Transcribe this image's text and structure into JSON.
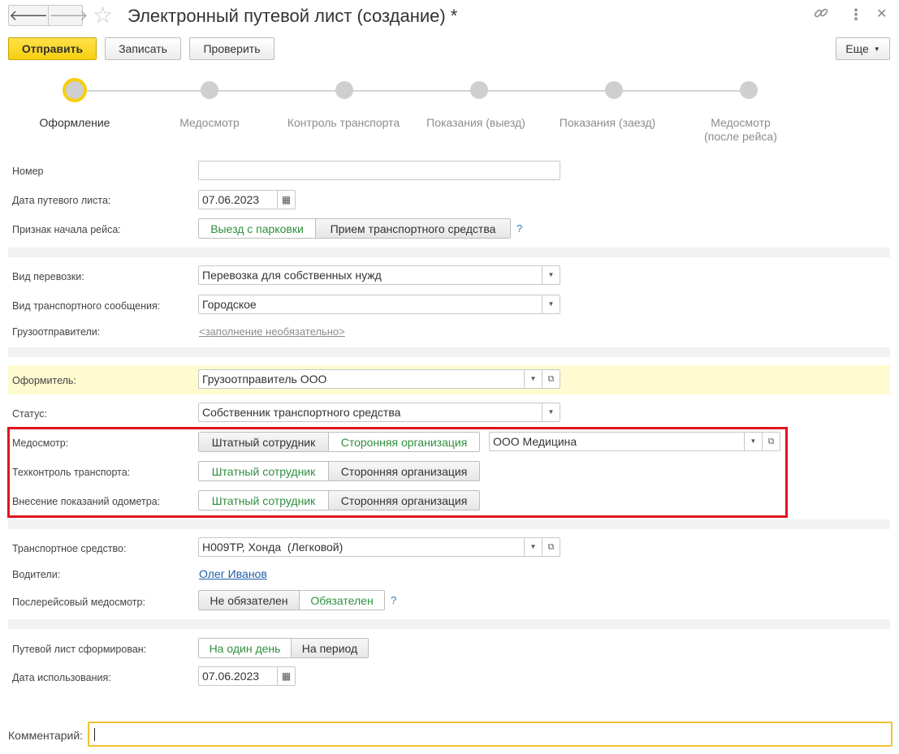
{
  "window": {
    "title": "Электронный путевой лист (создание) *"
  },
  "header": {
    "back_icon": "arrow-left-icon",
    "forward_icon": "arrow-right-icon",
    "favorite_icon": "star-icon",
    "link_icon": "link-icon",
    "more_icon": "more-vertical-icon",
    "close_icon": "close-icon"
  },
  "toolbar": {
    "send_label": "Отправить",
    "save_label": "Записать",
    "check_label": "Проверить",
    "more_label": "Еще"
  },
  "steps": [
    {
      "label": "Оформление"
    },
    {
      "label": "Медосмотр"
    },
    {
      "label": "Контроль транспорта"
    },
    {
      "label": "Показания (выезд)"
    },
    {
      "label": "Показания (заезд)"
    },
    {
      "label_line1": "Медосмотр",
      "label_line2": "(после рейса)"
    }
  ],
  "form": {
    "number": {
      "label": "Номер",
      "value": ""
    },
    "date": {
      "label": "Дата путевого листа:",
      "value": "07.06.2023"
    },
    "trip_start": {
      "label": "Признак начала рейса:",
      "option1": "Выезд с парковки",
      "option2": "Прием транспортного средства",
      "help": "?"
    },
    "transport_type": {
      "label": "Вид перевозки:",
      "value": "Перевозка для собственных нужд"
    },
    "connection_type": {
      "label": "Вид транспортного сообщения:",
      "value": "Городское"
    },
    "shippers": {
      "label": "Грузоотправители:",
      "value": "<заполнение необязательно>"
    },
    "issuer": {
      "label": "Оформитель:",
      "value": "Грузоотправитель ООО"
    },
    "status": {
      "label": "Статус:",
      "value": "Собственник транспортного средства"
    },
    "medical": {
      "label": "Медосмотр:",
      "option1": "Штатный сотрудник",
      "option2": "Сторонняя организация",
      "org": "ООО Медицина"
    },
    "tech_control": {
      "label": "Техконтроль транспорта:",
      "option1": "Штатный сотрудник",
      "option2": "Сторонняя организация"
    },
    "odometer": {
      "label": "Внесение показаний одометра:",
      "option1": "Штатный сотрудник",
      "option2": "Сторонняя организация"
    },
    "vehicle": {
      "label": "Транспортное средство:",
      "value": "Н009ТР, Хонда  (Легковой)"
    },
    "drivers": {
      "label": "Водители:",
      "value": "Олег Иванов"
    },
    "post_medical": {
      "label": "Послерейсовый медосмотр:",
      "option1": "Не обязателен",
      "option2": "Обязателен",
      "help": "?"
    },
    "formed": {
      "label": "Путевой лист сформирован:",
      "option1": "На один день",
      "option2": "На период"
    },
    "usage_date": {
      "label": "Дата использования:",
      "value": "07.06.2023"
    },
    "comment": {
      "label": "Комментарий:",
      "value": ""
    }
  },
  "colors": {
    "accent_yellow": "#f7cf0f",
    "selected_green": "#2f8f3e",
    "highlight_row": "#fffbd1",
    "highlight_frame": "#e0141e",
    "link_blue": "#1d5ea8"
  }
}
